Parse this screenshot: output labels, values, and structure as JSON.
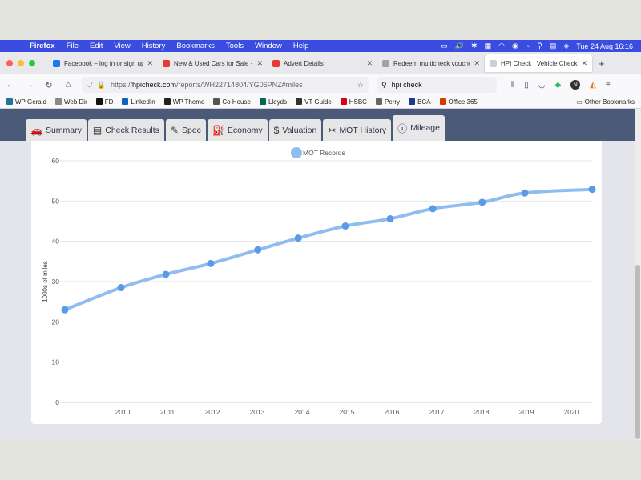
{
  "menubar": {
    "app_name": "Firefox",
    "items": [
      "File",
      "Edit",
      "View",
      "History",
      "Bookmarks",
      "Tools",
      "Window",
      "Help"
    ],
    "clock": "Tue 24 Aug  16:16"
  },
  "tabs": [
    {
      "label": "Facebook – log in or sign up",
      "color": "#1877f2"
    },
    {
      "label": "New & Used Cars for Sale - Au",
      "color": "#e83a2e"
    },
    {
      "label": "Advert Details",
      "color": "#e83a2e"
    },
    {
      "label": "Redeem multicheck voucher |",
      "color": "#9aa3ad"
    },
    {
      "label": "HPI Check | Vehicle Check | Re",
      "color": "#c8d0da"
    }
  ],
  "urlbar": {
    "prefix": "https://",
    "host": "hpicheck.com",
    "path": "/reports/WH22714804/YG06PNZ#miles"
  },
  "searchbar": {
    "value": "hpi check"
  },
  "bookmarks": [
    {
      "label": "WP Gerald",
      "color": "#21759b"
    },
    {
      "label": "Web Dir",
      "color": "#888888"
    },
    {
      "label": "FD",
      "color": "#111111"
    },
    {
      "label": "LinkedIn",
      "color": "#0a66c2"
    },
    {
      "label": "WP Theme",
      "color": "#222222"
    },
    {
      "label": "Co House",
      "color": "#555555"
    },
    {
      "label": "Lloyds",
      "color": "#006a4d"
    },
    {
      "label": "VT Guide",
      "color": "#333333"
    },
    {
      "label": "HSBC",
      "color": "#db0011"
    },
    {
      "label": "Perry",
      "color": "#666666"
    },
    {
      "label": "BCA",
      "color": "#1b3a8a"
    },
    {
      "label": "Office 365",
      "color": "#d83b01"
    }
  ],
  "other_bookmarks": "Other Bookmarks",
  "report_tabs": [
    {
      "label": "Summary",
      "icon": "car-icon"
    },
    {
      "label": "Check Results",
      "icon": "table-icon"
    },
    {
      "label": "Spec",
      "icon": "edit-icon"
    },
    {
      "label": "Economy",
      "icon": "fuel-pump-icon"
    },
    {
      "label": "Valuation",
      "icon": "money-bag-icon"
    },
    {
      "label": "MOT History",
      "icon": "tools-icon"
    },
    {
      "label": "Mileage",
      "icon": "info-icon"
    }
  ],
  "active_report_tab": "Mileage",
  "chart_data": {
    "type": "line",
    "ylabel": "1000s of miles",
    "xlabel": "",
    "ylim": [
      0,
      60
    ],
    "yticks": [
      0,
      10,
      20,
      30,
      40,
      50,
      60
    ],
    "xticks": [
      "2010",
      "2011",
      "2012",
      "2013",
      "2014",
      "2015",
      "2016",
      "2017",
      "2018",
      "2019",
      "2020"
    ],
    "xlim": [
      2009.0,
      2020.75
    ],
    "grid": true,
    "legend_position": "top-center",
    "series": [
      {
        "name": "MOT Records",
        "color": "#8fbdf0",
        "point_color": "#5a9be8",
        "x": [
          2009.0,
          2010.25,
          2011.25,
          2012.25,
          2013.3,
          2014.2,
          2015.25,
          2016.25,
          2017.2,
          2018.3,
          2019.25,
          2020.75
        ],
        "values": [
          23,
          28.5,
          31.8,
          34.5,
          37.9,
          40.8,
          43.8,
          45.6,
          48.1,
          49.7,
          52,
          52.9
        ]
      }
    ]
  }
}
